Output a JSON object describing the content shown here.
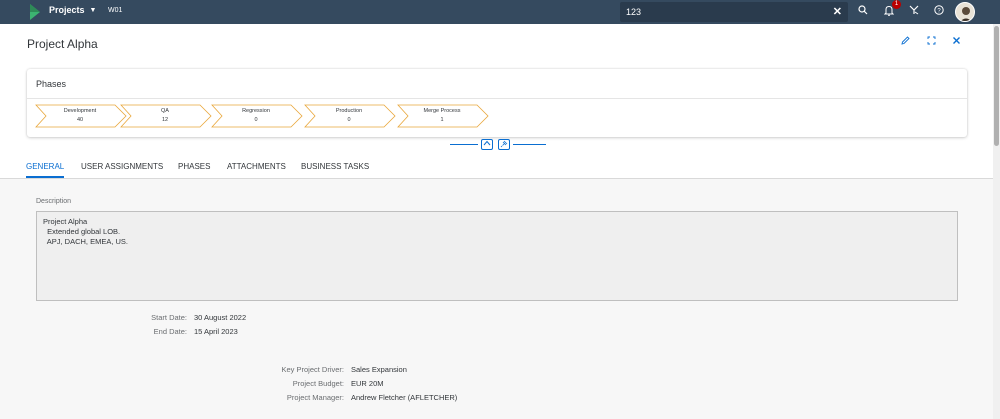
{
  "shell": {
    "app_title": "Projects",
    "system_id": "W01",
    "search_value": "123",
    "notification_count": "1"
  },
  "header": {
    "title": "Project Alpha"
  },
  "phases": {
    "title": "Phases",
    "items": [
      {
        "name": "Development",
        "count": "40"
      },
      {
        "name": "QA",
        "count": "12"
      },
      {
        "name": "Regression",
        "count": "0"
      },
      {
        "name": "Production",
        "count": "0"
      },
      {
        "name": "Merge Process",
        "count": "1"
      }
    ],
    "accent_color": "#e9a73b"
  },
  "tabs": [
    {
      "label": "GENERAL",
      "active": true
    },
    {
      "label": "USER ASSIGNMENTS",
      "active": false
    },
    {
      "label": "PHASES",
      "active": false
    },
    {
      "label": "ATTACHMENTS",
      "active": false
    },
    {
      "label": "BUSINESS TASKS",
      "active": false
    }
  ],
  "general": {
    "description_label": "Description",
    "description_lines": [
      "Project Alpha",
      "  Extended global LOB.",
      "  APJ, DACH, EMEA, US."
    ],
    "dates": [
      {
        "label": "Start Date:",
        "value": "30 August 2022"
      },
      {
        "label": "End Date:",
        "value": "15 April 2023"
      }
    ],
    "details": [
      {
        "label": "Key Project Driver:",
        "value": "Sales Expansion"
      },
      {
        "label": "Project Budget:",
        "value": "EUR 20M"
      },
      {
        "label": "Project Manager:",
        "value": "Andrew Fletcher (AFLETCHER)"
      }
    ]
  },
  "colors": {
    "shell_bg": "#354a5f",
    "accent": "#0a6ed1",
    "notification": "#bb0000"
  }
}
